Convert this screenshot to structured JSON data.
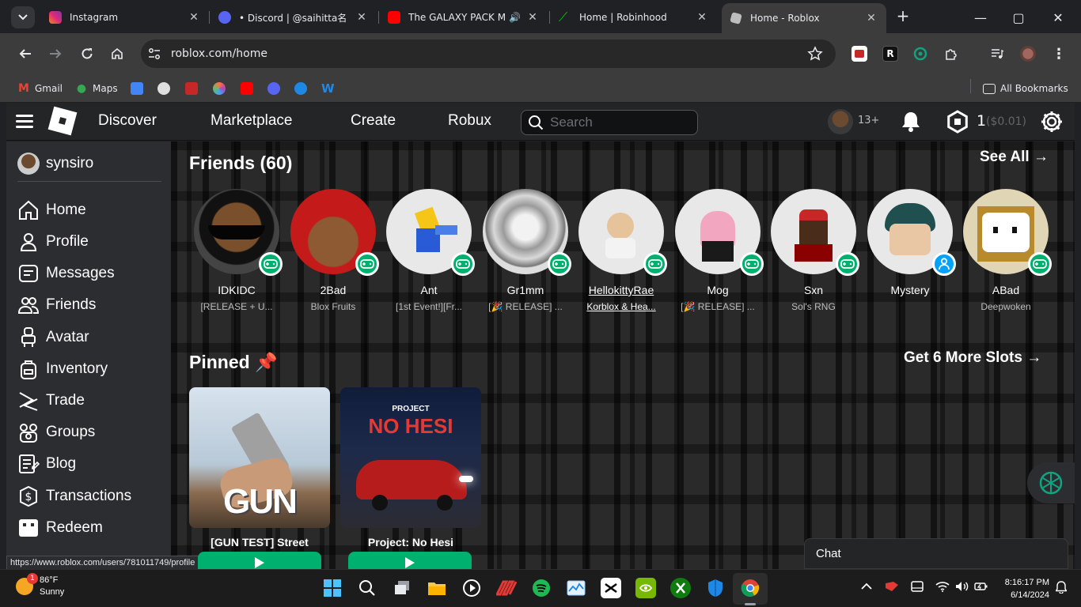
{
  "browser": {
    "tabs": [
      {
        "title": "Instagram",
        "color": "#d6249f"
      },
      {
        "title": "• Discord | @saihitta名",
        "color": "#5865f2"
      },
      {
        "title": "The GALAXY PACK Ma",
        "color": "#ff0000"
      },
      {
        "title": "Home | Robinhood",
        "color": "#00c805"
      },
      {
        "title": "Home - Roblox",
        "color": "#9e9e9e"
      }
    ],
    "url": "roblox.com/home",
    "bookmarks": [
      {
        "label": "Gmail",
        "color": "#ea4335"
      },
      {
        "label": "Maps",
        "color": "#34a853"
      },
      {
        "label": "",
        "color": "#4285f4"
      },
      {
        "label": "",
        "color": "#e0e0e0"
      },
      {
        "label": "",
        "color": "#c62828"
      },
      {
        "label": "",
        "color": "#ff7043"
      },
      {
        "label": "",
        "color": "#ff0000"
      },
      {
        "label": "",
        "color": "#5865f2"
      },
      {
        "label": "",
        "color": "#1e88e5"
      },
      {
        "label": "",
        "color": "#1e88e5"
      }
    ],
    "all_bookmarks": "All Bookmarks"
  },
  "roblox": {
    "nav": {
      "discover": "Discover",
      "marketplace": "Marketplace",
      "create": "Create",
      "robux": "Robux",
      "search_placeholder": "Search",
      "age": "13+",
      "robux_count": "1",
      "robux_usd": "($0.01)"
    },
    "sidebar": {
      "username": "synsiro",
      "items": [
        {
          "label": "Home",
          "icon": "home-icon"
        },
        {
          "label": "Profile",
          "icon": "profile-icon"
        },
        {
          "label": "Messages",
          "icon": "messages-icon"
        },
        {
          "label": "Friends",
          "icon": "friends-icon"
        },
        {
          "label": "Avatar",
          "icon": "avatar-icon"
        },
        {
          "label": "Inventory",
          "icon": "inventory-icon"
        },
        {
          "label": "Trade",
          "icon": "trade-icon"
        },
        {
          "label": "Groups",
          "icon": "groups-icon"
        },
        {
          "label": "Blog",
          "icon": "blog-icon"
        },
        {
          "label": "Transactions",
          "icon": "transactions-icon"
        },
        {
          "label": "Redeem",
          "icon": "redeem-icon"
        }
      ]
    },
    "friends": {
      "title": "Friends (60)",
      "see_all": "See All →",
      "list": [
        {
          "name": "IDKIDC",
          "game": "[RELEASE + U...",
          "status": "in-game"
        },
        {
          "name": "2Bad",
          "game": "Blox Fruits",
          "status": "in-game"
        },
        {
          "name": "Ant",
          "game": "[1st Event!][Fr...",
          "status": "in-game"
        },
        {
          "name": "Gr1mm",
          "game": "[🎉 RELEASE] ...",
          "status": "in-game"
        },
        {
          "name": "HellokittyRae",
          "game": "Korblox & Hea...",
          "status": "in-game"
        },
        {
          "name": "Mog",
          "game": "[🎉 RELEASE] ...",
          "status": "in-game"
        },
        {
          "name": "Sxn",
          "game": "Sol's RNG",
          "status": "in-game"
        },
        {
          "name": "Mystery",
          "game": "",
          "status": "online"
        },
        {
          "name": "ABad",
          "game": "Deepwoken",
          "status": "in-game"
        }
      ]
    },
    "pinned": {
      "title": "Pinned 📌",
      "more_slots": "Get 6 More Slots →",
      "games": [
        {
          "name": "[GUN TEST] Street",
          "thumb_text": "GUN TEST"
        },
        {
          "name": "Project: No Hesi",
          "thumb_top": "PROJECT",
          "thumb_text": "NO HESI"
        }
      ]
    },
    "chat_label": "Chat"
  },
  "status_url": "https://www.roblox.com/users/781011749/profile",
  "taskbar": {
    "temp": "86°F",
    "weather": "Sunny",
    "weather_badge": "1",
    "time": "8:16:17 PM",
    "date": "6/14/2024"
  },
  "colors": {
    "accent_green": "#00b06f",
    "online_blue": "#00a2ff"
  }
}
